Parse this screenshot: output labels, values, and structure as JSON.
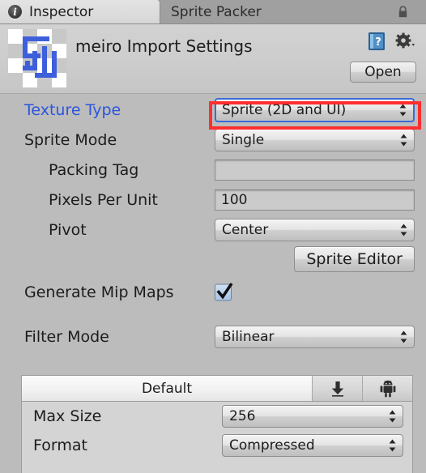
{
  "window": {
    "tabs": [
      {
        "label": "Inspector",
        "icon": "info-icon",
        "active": true
      },
      {
        "label": "Sprite Packer",
        "icon": null,
        "active": false
      }
    ],
    "lock_icon": "lock-icon"
  },
  "header": {
    "title": "meiro Import Settings",
    "preview_icon": "sprite-preview-maze",
    "help_icon": "help-book-icon",
    "gear_icon": "gear-icon",
    "open_label": "Open"
  },
  "properties": {
    "texture_type": {
      "label": "Texture Type",
      "value": "Sprite (2D and UI)"
    },
    "sprite_mode": {
      "label": "Sprite Mode",
      "value": "Single"
    },
    "packing_tag": {
      "label": "Packing Tag",
      "value": "",
      "placeholder": ""
    },
    "pixels_per_unit": {
      "label": "Pixels Per Unit",
      "value": "100"
    },
    "pivot": {
      "label": "Pivot",
      "value": "Center"
    },
    "sprite_editor_label": "Sprite Editor",
    "generate_mip_maps": {
      "label": "Generate Mip Maps",
      "checked": true
    },
    "filter_mode": {
      "label": "Filter Mode",
      "value": "Bilinear"
    }
  },
  "platform": {
    "tabs": [
      {
        "label": "Default",
        "icon": null,
        "active": true
      },
      {
        "label": "",
        "icon": "standalone-download-icon",
        "active": false
      },
      {
        "label": "",
        "icon": "android-robot-icon",
        "active": false
      }
    ],
    "max_size": {
      "label": "Max Size",
      "value": "256"
    },
    "format": {
      "label": "Format",
      "value": "Compressed"
    }
  },
  "annotation": {
    "highlight_color": "#ff2f2f",
    "target": "texture-type-dropdown"
  }
}
